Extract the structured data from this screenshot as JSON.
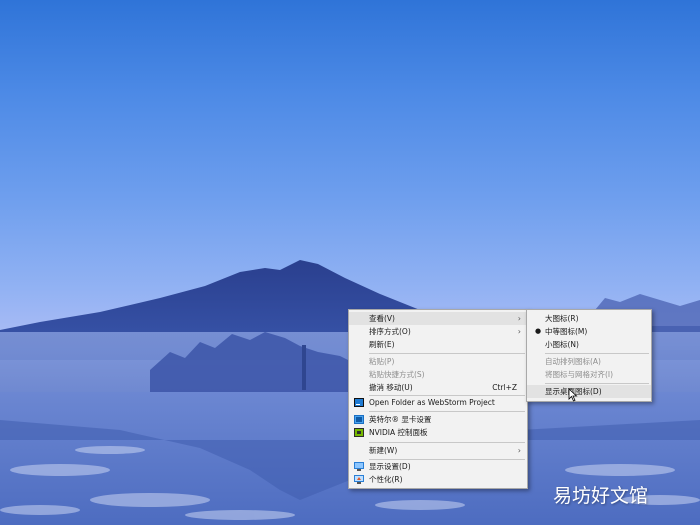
{
  "context_menu": {
    "items": [
      {
        "label": "查看(V)",
        "submenu": true
      },
      {
        "label": "排序方式(O)",
        "submenu": true
      },
      {
        "label": "刷新(E)"
      },
      {
        "label": "粘贴(P)",
        "disabled": true
      },
      {
        "label": "粘贴快捷方式(S)",
        "disabled": true
      },
      {
        "label": "撤消 移动(U)",
        "shortcut": "Ctrl+Z"
      },
      {
        "label": "Open Folder as WebStorm Project",
        "icon": "webstorm-icon"
      },
      {
        "label": "英特尔® 显卡设置",
        "icon": "intel-graphics-icon"
      },
      {
        "label": "NVIDIA 控制面板",
        "icon": "nvidia-icon"
      },
      {
        "label": "新建(W)",
        "submenu": true
      },
      {
        "label": "显示设置(D)",
        "icon": "display-icon"
      },
      {
        "label": "个性化(R)",
        "icon": "personalize-icon"
      }
    ]
  },
  "view_submenu": {
    "items": [
      {
        "label": "大图标(R)"
      },
      {
        "label": "中等图标(M)",
        "checked": true
      },
      {
        "label": "小图标(N)"
      },
      {
        "label": "自动排列图标(A)",
        "disabled": true
      },
      {
        "label": "将图标与网格对齐(I)",
        "disabled": true
      },
      {
        "label": "显示桌面图标(D)",
        "hover": true
      }
    ]
  },
  "watermark": {
    "text": "易坊好文馆"
  },
  "colors": {
    "menu_bg": "#f2f2f2",
    "highlight": "#e2e2e2",
    "disabled_text": "#8d8d8d"
  }
}
